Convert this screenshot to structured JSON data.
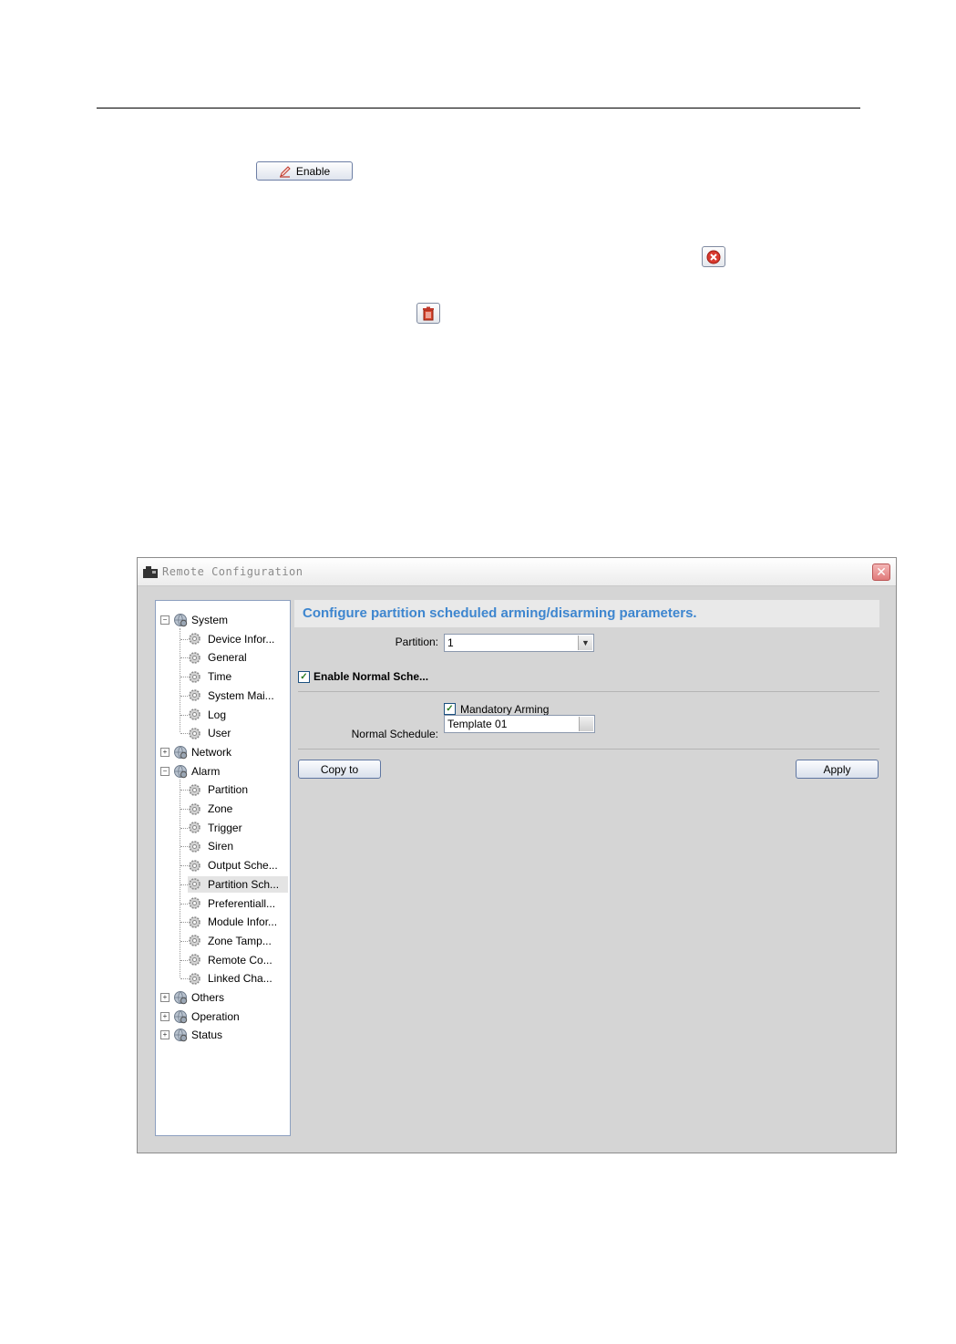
{
  "page": {
    "enable_button_label": "Enable"
  },
  "window": {
    "title": "Remote Configuration",
    "close_symbol": "✕"
  },
  "tree": {
    "groups": [
      {
        "label": "System",
        "expanded": true,
        "children": [
          "Device Infor...",
          "General",
          "Time",
          "System Mai...",
          "Log",
          "User"
        ]
      },
      {
        "label": "Network",
        "expanded": false,
        "children": []
      },
      {
        "label": "Alarm",
        "expanded": true,
        "children": [
          "Partition",
          "Zone",
          "Trigger",
          "Siren",
          "Output Sche...",
          "Partition Sch...",
          "Preferentiall...",
          "Module Infor...",
          "Zone Tamp...",
          "Remote Co...",
          "Linked Cha..."
        ]
      },
      {
        "label": "Others",
        "expanded": false,
        "children": []
      },
      {
        "label": "Operation",
        "expanded": false,
        "children": []
      },
      {
        "label": "Status",
        "expanded": false,
        "children": []
      }
    ],
    "selected": "Partition Sch..."
  },
  "panel": {
    "header": "Configure partition scheduled arming/disarming parameters.",
    "partition_label": "Partition:",
    "partition_value": "1",
    "enable_normal_schedule_label": "Enable Normal Sche...",
    "enable_normal_schedule_checked": true,
    "mandatory_arming_label": "Mandatory Arming",
    "mandatory_arming_checked": true,
    "normal_schedule_label": "Normal Schedule:",
    "normal_schedule_value": "Template 01",
    "copy_to_label": "Copy to",
    "apply_label": "Apply"
  },
  "icons": {
    "enable": "pencil-icon",
    "cancel": "red-x-circle-icon",
    "delete": "trash-icon",
    "tree_group": "globe-gear-icon",
    "tree_item": "gear-icon"
  },
  "colors": {
    "header_text": "#3e86cf",
    "window_bg": "#d5d5d5",
    "close_button": "#e07a7a"
  }
}
